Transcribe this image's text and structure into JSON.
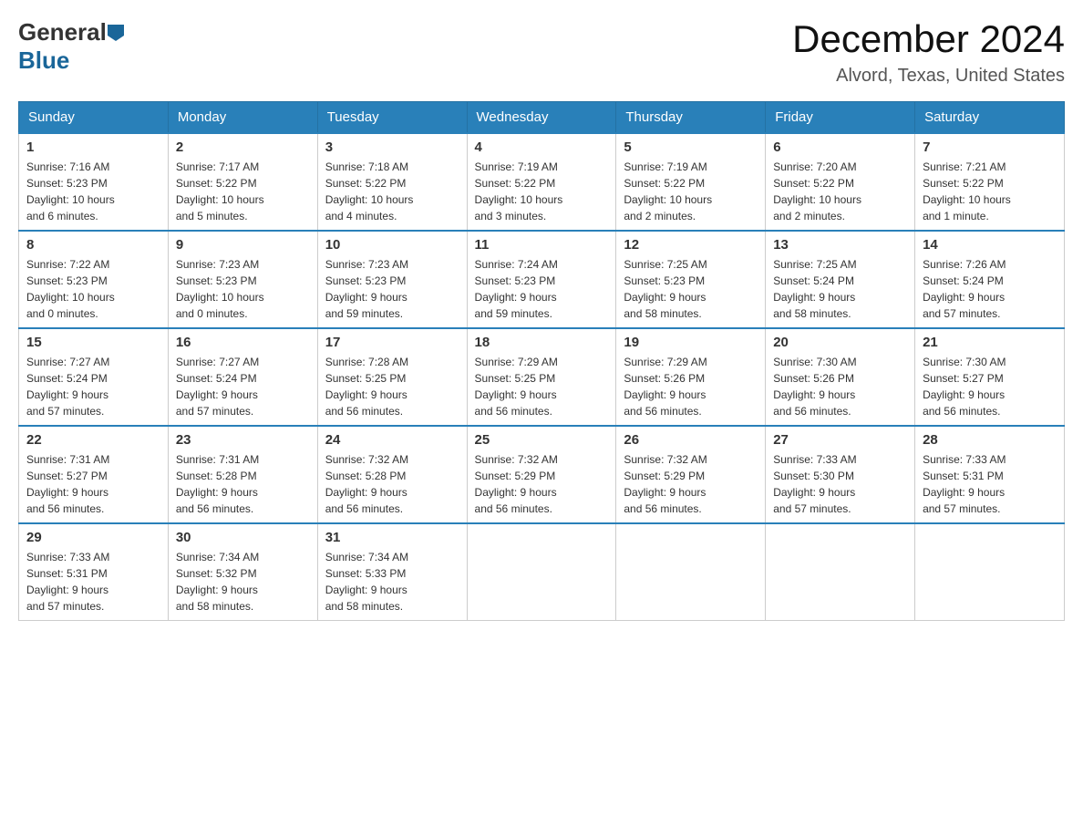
{
  "header": {
    "logo_general": "General",
    "logo_blue": "Blue",
    "title": "December 2024",
    "subtitle": "Alvord, Texas, United States"
  },
  "days_of_week": [
    "Sunday",
    "Monday",
    "Tuesday",
    "Wednesday",
    "Thursday",
    "Friday",
    "Saturday"
  ],
  "weeks": [
    [
      {
        "day": "1",
        "sunrise": "7:16 AM",
        "sunset": "5:23 PM",
        "daylight": "10 hours and 6 minutes."
      },
      {
        "day": "2",
        "sunrise": "7:17 AM",
        "sunset": "5:22 PM",
        "daylight": "10 hours and 5 minutes."
      },
      {
        "day": "3",
        "sunrise": "7:18 AM",
        "sunset": "5:22 PM",
        "daylight": "10 hours and 4 minutes."
      },
      {
        "day": "4",
        "sunrise": "7:19 AM",
        "sunset": "5:22 PM",
        "daylight": "10 hours and 3 minutes."
      },
      {
        "day": "5",
        "sunrise": "7:19 AM",
        "sunset": "5:22 PM",
        "daylight": "10 hours and 2 minutes."
      },
      {
        "day": "6",
        "sunrise": "7:20 AM",
        "sunset": "5:22 PM",
        "daylight": "10 hours and 2 minutes."
      },
      {
        "day": "7",
        "sunrise": "7:21 AM",
        "sunset": "5:22 PM",
        "daylight": "10 hours and 1 minute."
      }
    ],
    [
      {
        "day": "8",
        "sunrise": "7:22 AM",
        "sunset": "5:23 PM",
        "daylight": "10 hours and 0 minutes."
      },
      {
        "day": "9",
        "sunrise": "7:23 AM",
        "sunset": "5:23 PM",
        "daylight": "10 hours and 0 minutes."
      },
      {
        "day": "10",
        "sunrise": "7:23 AM",
        "sunset": "5:23 PM",
        "daylight": "9 hours and 59 minutes."
      },
      {
        "day": "11",
        "sunrise": "7:24 AM",
        "sunset": "5:23 PM",
        "daylight": "9 hours and 59 minutes."
      },
      {
        "day": "12",
        "sunrise": "7:25 AM",
        "sunset": "5:23 PM",
        "daylight": "9 hours and 58 minutes."
      },
      {
        "day": "13",
        "sunrise": "7:25 AM",
        "sunset": "5:24 PM",
        "daylight": "9 hours and 58 minutes."
      },
      {
        "day": "14",
        "sunrise": "7:26 AM",
        "sunset": "5:24 PM",
        "daylight": "9 hours and 57 minutes."
      }
    ],
    [
      {
        "day": "15",
        "sunrise": "7:27 AM",
        "sunset": "5:24 PM",
        "daylight": "9 hours and 57 minutes."
      },
      {
        "day": "16",
        "sunrise": "7:27 AM",
        "sunset": "5:24 PM",
        "daylight": "9 hours and 57 minutes."
      },
      {
        "day": "17",
        "sunrise": "7:28 AM",
        "sunset": "5:25 PM",
        "daylight": "9 hours and 56 minutes."
      },
      {
        "day": "18",
        "sunrise": "7:29 AM",
        "sunset": "5:25 PM",
        "daylight": "9 hours and 56 minutes."
      },
      {
        "day": "19",
        "sunrise": "7:29 AM",
        "sunset": "5:26 PM",
        "daylight": "9 hours and 56 minutes."
      },
      {
        "day": "20",
        "sunrise": "7:30 AM",
        "sunset": "5:26 PM",
        "daylight": "9 hours and 56 minutes."
      },
      {
        "day": "21",
        "sunrise": "7:30 AM",
        "sunset": "5:27 PM",
        "daylight": "9 hours and 56 minutes."
      }
    ],
    [
      {
        "day": "22",
        "sunrise": "7:31 AM",
        "sunset": "5:27 PM",
        "daylight": "9 hours and 56 minutes."
      },
      {
        "day": "23",
        "sunrise": "7:31 AM",
        "sunset": "5:28 PM",
        "daylight": "9 hours and 56 minutes."
      },
      {
        "day": "24",
        "sunrise": "7:32 AM",
        "sunset": "5:28 PM",
        "daylight": "9 hours and 56 minutes."
      },
      {
        "day": "25",
        "sunrise": "7:32 AM",
        "sunset": "5:29 PM",
        "daylight": "9 hours and 56 minutes."
      },
      {
        "day": "26",
        "sunrise": "7:32 AM",
        "sunset": "5:29 PM",
        "daylight": "9 hours and 56 minutes."
      },
      {
        "day": "27",
        "sunrise": "7:33 AM",
        "sunset": "5:30 PM",
        "daylight": "9 hours and 57 minutes."
      },
      {
        "day": "28",
        "sunrise": "7:33 AM",
        "sunset": "5:31 PM",
        "daylight": "9 hours and 57 minutes."
      }
    ],
    [
      {
        "day": "29",
        "sunrise": "7:33 AM",
        "sunset": "5:31 PM",
        "daylight": "9 hours and 57 minutes."
      },
      {
        "day": "30",
        "sunrise": "7:34 AM",
        "sunset": "5:32 PM",
        "daylight": "9 hours and 58 minutes."
      },
      {
        "day": "31",
        "sunrise": "7:34 AM",
        "sunset": "5:33 PM",
        "daylight": "9 hours and 58 minutes."
      },
      null,
      null,
      null,
      null
    ]
  ],
  "labels": {
    "sunrise": "Sunrise:",
    "sunset": "Sunset:",
    "daylight": "Daylight:"
  }
}
